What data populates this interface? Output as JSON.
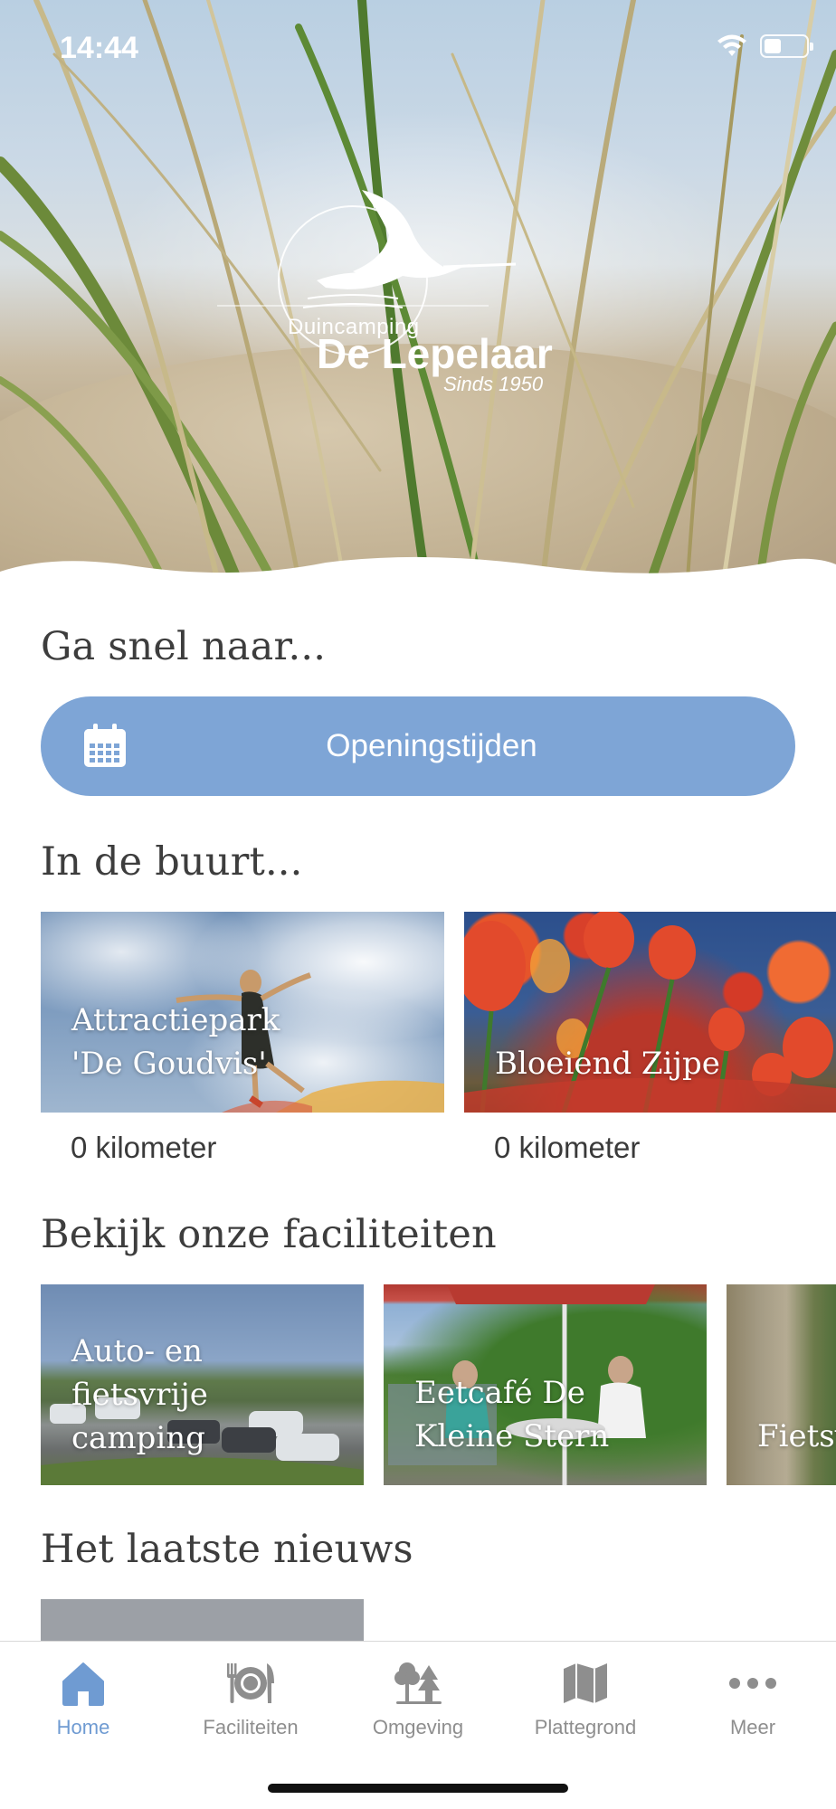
{
  "status_bar": {
    "time": "14:44",
    "icons": [
      "wifi-icon",
      "battery-icon"
    ]
  },
  "hero": {
    "logo": {
      "small_text": "Duincamping",
      "name": "De Lepelaar",
      "since": "Sinds 1950",
      "icon": "spoonbill-bird-icon"
    }
  },
  "quick_access": {
    "title": "Ga snel naar...",
    "button": {
      "label": "Openingstijden",
      "icon": "calendar-icon",
      "color": "#7ea5d6"
    }
  },
  "nearby": {
    "title": "In de buurt...",
    "items": [
      {
        "title_line1": "Attractiepark",
        "title_line2": "'De Goudvis'",
        "distance": "0 kilometer"
      },
      {
        "title_line1": "Bloeiend Zijpe",
        "distance": "0 kilometer"
      }
    ]
  },
  "facilities": {
    "title": "Bekijk onze faciliteiten",
    "items": [
      {
        "title_line1": "Auto- en",
        "title_line2": "fietsvrije",
        "title_line3": "camping"
      },
      {
        "title_line1": "Eetcafé De",
        "title_line2": "Kleine Stern"
      },
      {
        "title_line1": "Fietsv"
      }
    ]
  },
  "news": {
    "title": "Het laatste nieuws"
  },
  "tabbar": {
    "active_color": "#6f9bd2",
    "inactive_color": "#8e8e8e",
    "tabs": [
      {
        "label": "Home",
        "icon": "home-icon",
        "active": true
      },
      {
        "label": "Faciliteiten",
        "icon": "cutlery-icon",
        "active": false
      },
      {
        "label": "Omgeving",
        "icon": "trees-icon",
        "active": false
      },
      {
        "label": "Plattegrond",
        "icon": "map-icon",
        "active": false
      },
      {
        "label": "Meer",
        "icon": "more-icon",
        "active": false
      }
    ]
  }
}
